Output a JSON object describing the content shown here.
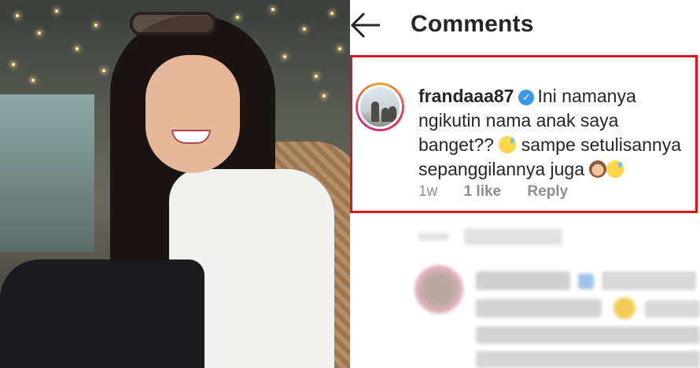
{
  "header": {
    "title": "Comments"
  },
  "comment": {
    "username": "frandaaa87",
    "text_line1": "Ini namanya",
    "text_line2": "ngikutin nama anak saya",
    "text_line3": "banget??",
    "text_line3b": "sampe setulisannya",
    "text_line4": "sepanggilannya juga",
    "time": "1w",
    "likes": "1 like",
    "reply_label": "Reply"
  },
  "icons": {
    "back": "back-arrow-icon",
    "verified": "verified-badge-icon"
  },
  "colors": {
    "highlight_border": "#e0141e",
    "verified_blue": "#3897f0",
    "text": "#262626",
    "meta": "#8e8e8e"
  }
}
